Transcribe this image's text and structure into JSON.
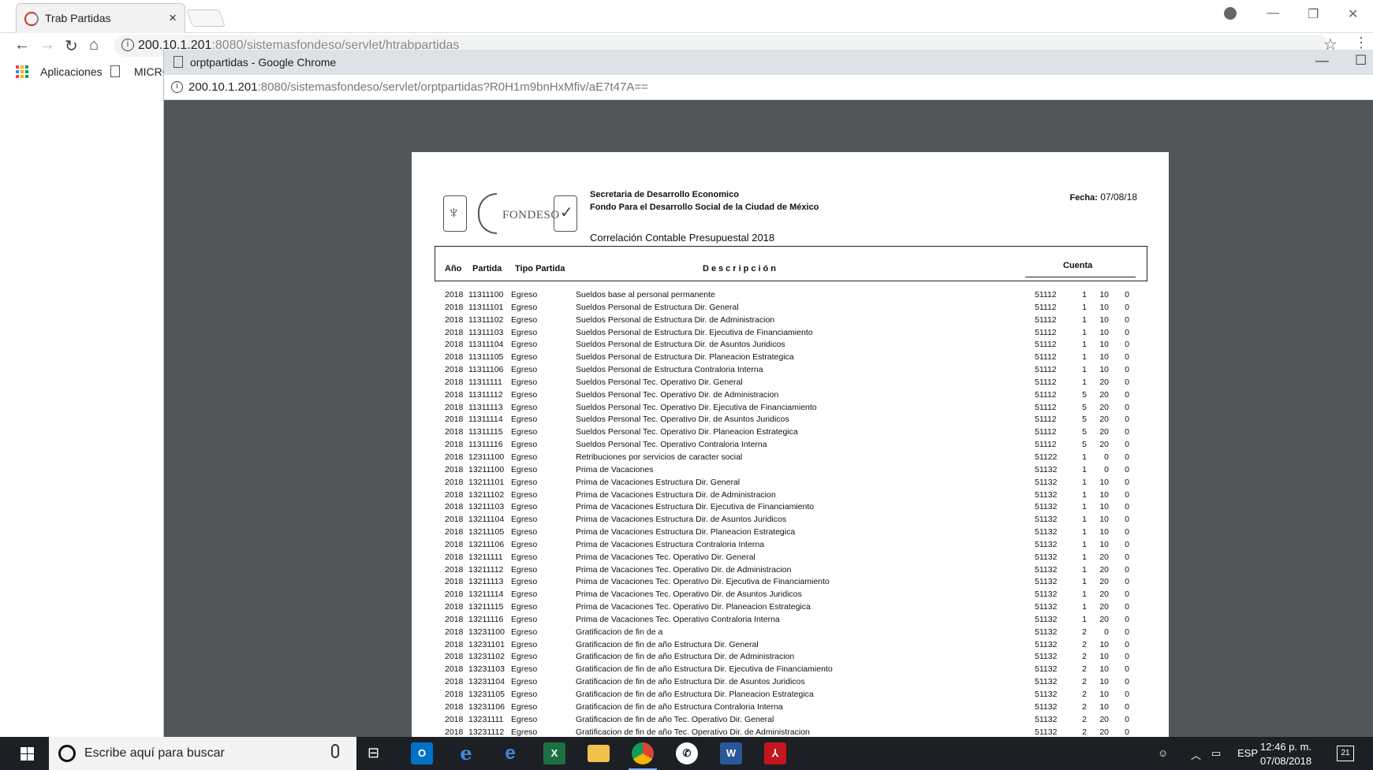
{
  "browser": {
    "tab_title": "Trab Partidas",
    "tab_close": "×",
    "url_host": "200.10.1.201",
    "url_rest": ":8080/sistemasfondeso/servlet/htrabpartidas",
    "bookmarks": {
      "apps_label": "Aplicaciones",
      "bookmark_label": "MICRO"
    }
  },
  "popup": {
    "window_title": "orptpartidas - Google Chrome",
    "url_host": "200.10.1.201",
    "url_rest": ":8080/sistemasfondeso/servlet/orptpartidas?R0H1m9bnHxMfiv/aE7t47A=="
  },
  "report": {
    "logo_text": "FONDESO",
    "org_line1": "Secretaria de Desarrollo Economico",
    "org_line2": "Fondo Para el Desarrollo Social de la Ciudad de México",
    "title": "Correlación Contable Presupuestal 2018",
    "fecha_label": "Fecha:",
    "fecha_value": "07/08/18",
    "columns": {
      "anio": "Año",
      "partida": "Partida",
      "tipo": "Tipo Partida",
      "descripcion": "Descripción",
      "cuenta": "Cuenta"
    },
    "rows": [
      [
        "2018",
        "11311100",
        "Egreso",
        "Sueldos base al personal permanente",
        "51112",
        "1",
        "10",
        "0"
      ],
      [
        "2018",
        "11311101",
        "Egreso",
        "Sueldos Personal de Estructura Dir. General",
        "51112",
        "1",
        "10",
        "0"
      ],
      [
        "2018",
        "11311102",
        "Egreso",
        "Sueldos Personal de Estructura Dir. de Administracion",
        "51112",
        "1",
        "10",
        "0"
      ],
      [
        "2018",
        "11311103",
        "Egreso",
        "Sueldos Personal de Estructura Dir. Ejecutiva de Financiamiento",
        "51112",
        "1",
        "10",
        "0"
      ],
      [
        "2018",
        "11311104",
        "Egreso",
        "Sueldos Personal de Estructura Dir. de Asuntos Juridicos",
        "51112",
        "1",
        "10",
        "0"
      ],
      [
        "2018",
        "11311105",
        "Egreso",
        "Sueldos Personal de Estructura Dir. Planeacion Estrategica",
        "51112",
        "1",
        "10",
        "0"
      ],
      [
        "2018",
        "11311106",
        "Egreso",
        "Sueldos Personal de Estructura Contraloria Interna",
        "51112",
        "1",
        "10",
        "0"
      ],
      [
        "2018",
        "11311111",
        "Egreso",
        "Sueldos Personal Tec. Operativo Dir. General",
        "51112",
        "1",
        "20",
        "0"
      ],
      [
        "2018",
        "11311112",
        "Egreso",
        "Sueldos Personal Tec. Operativo Dir. de Administracion",
        "51112",
        "5",
        "20",
        "0"
      ],
      [
        "2018",
        "11311113",
        "Egreso",
        "Sueldos Personal Tec. Operativo Dir. Ejecutiva de Financiamiento",
        "51112",
        "5",
        "20",
        "0"
      ],
      [
        "2018",
        "11311114",
        "Egreso",
        "Sueldos Personal Tec. Operativo Dir. de Asuntos Juridicos",
        "51112",
        "5",
        "20",
        "0"
      ],
      [
        "2018",
        "11311115",
        "Egreso",
        "Sueldos Personal Tec. Operativo Dir. Planeacion Estrategica",
        "51112",
        "5",
        "20",
        "0"
      ],
      [
        "2018",
        "11311116",
        "Egreso",
        "Sueldos Personal Tec. Operativo Contraloria Interna",
        "51112",
        "5",
        "20",
        "0"
      ],
      [
        "2018",
        "12311100",
        "Egreso",
        "Retribuciones por servicios de caracter social",
        "51122",
        "1",
        "0",
        "0"
      ],
      [
        "2018",
        "13211100",
        "Egreso",
        "Prima de Vacaciones",
        "51132",
        "1",
        "0",
        "0"
      ],
      [
        "2018",
        "13211101",
        "Egreso",
        "Prima de Vacaciones Estructura Dir. General",
        "51132",
        "1",
        "10",
        "0"
      ],
      [
        "2018",
        "13211102",
        "Egreso",
        "Prima de Vacaciones Estructura Dir. de Administracion",
        "51132",
        "1",
        "10",
        "0"
      ],
      [
        "2018",
        "13211103",
        "Egreso",
        "Prima de Vacaciones Estructura Dir. Ejecutiva de Financiamiento",
        "51132",
        "1",
        "10",
        "0"
      ],
      [
        "2018",
        "13211104",
        "Egreso",
        "Prima de Vacaciones Estructura Dir. de Asuntos Juridicos",
        "51132",
        "1",
        "10",
        "0"
      ],
      [
        "2018",
        "13211105",
        "Egreso",
        "Prima de Vacaciones Estructura Dir. Planeacion Estrategica",
        "51132",
        "1",
        "10",
        "0"
      ],
      [
        "2018",
        "13211106",
        "Egreso",
        "Prima de Vacaciones Estructura Contraloria Interna",
        "51132",
        "1",
        "10",
        "0"
      ],
      [
        "2018",
        "13211111",
        "Egreso",
        "Prima de Vacaciones Tec. Operativo Dir. General",
        "51132",
        "1",
        "20",
        "0"
      ],
      [
        "2018",
        "13211112",
        "Egreso",
        "Prima de Vacaciones Tec. Operativo Dir. de Administracion",
        "51132",
        "1",
        "20",
        "0"
      ],
      [
        "2018",
        "13211113",
        "Egreso",
        "Prima de Vacaciones Tec. Operativo Dir. Ejecutiva de Financiamiento",
        "51132",
        "1",
        "20",
        "0"
      ],
      [
        "2018",
        "13211114",
        "Egreso",
        "Prima de Vacaciones Tec. Operativo Dir. de Asuntos Juridicos",
        "51132",
        "1",
        "20",
        "0"
      ],
      [
        "2018",
        "13211115",
        "Egreso",
        "Prima de Vacaciones Tec. Operativo Dir. Planeacion Estrategica",
        "51132",
        "1",
        "20",
        "0"
      ],
      [
        "2018",
        "13211116",
        "Egreso",
        "Prima de Vacaciones Tec. Operativo Contraloria Interna",
        "51132",
        "1",
        "20",
        "0"
      ],
      [
        "2018",
        "13231100",
        "Egreso",
        "Gratificacion de fin de a",
        "51132",
        "2",
        "0",
        "0"
      ],
      [
        "2018",
        "13231101",
        "Egreso",
        "Gratificacion de fin de año Estructura Dir. General",
        "51132",
        "2",
        "10",
        "0"
      ],
      [
        "2018",
        "13231102",
        "Egreso",
        "Gratificacion de fin de año Estructura Dir. de Administracion",
        "51132",
        "2",
        "10",
        "0"
      ],
      [
        "2018",
        "13231103",
        "Egreso",
        "Gratificacion de fin de año Estructura Dir. Ejecutiva de Financiamiento",
        "51132",
        "2",
        "10",
        "0"
      ],
      [
        "2018",
        "13231104",
        "Egreso",
        "Gratificacion de fin de año Estructura Dir. de Asuntos Juridicos",
        "51132",
        "2",
        "10",
        "0"
      ],
      [
        "2018",
        "13231105",
        "Egreso",
        "Gratificacion de fin de año Estructura Dir. Planeacion Estrategica",
        "51132",
        "2",
        "10",
        "0"
      ],
      [
        "2018",
        "13231106",
        "Egreso",
        "Gratificacion de fin de año Estructura Contraloria Interna",
        "51132",
        "2",
        "10",
        "0"
      ],
      [
        "2018",
        "13231111",
        "Egreso",
        "Gratificacion de fin de año Tec. Operativo Dir. General",
        "51132",
        "2",
        "20",
        "0"
      ],
      [
        "2018",
        "13231112",
        "Egreso",
        "Gratificacion de fin de año Tec. Operativo Dir. de Administracion",
        "51132",
        "2",
        "20",
        "0"
      ]
    ]
  },
  "taskbar": {
    "search_placeholder": "Escribe aquí para buscar",
    "language": "ESP",
    "time": "12:46 p. m.",
    "date": "07/08/2018",
    "notification_count": "21",
    "apps": [
      "outlook",
      "internet-explorer",
      "edge",
      "excel",
      "file-explorer",
      "chrome",
      "whatsapp",
      "word",
      "acrobat"
    ]
  }
}
